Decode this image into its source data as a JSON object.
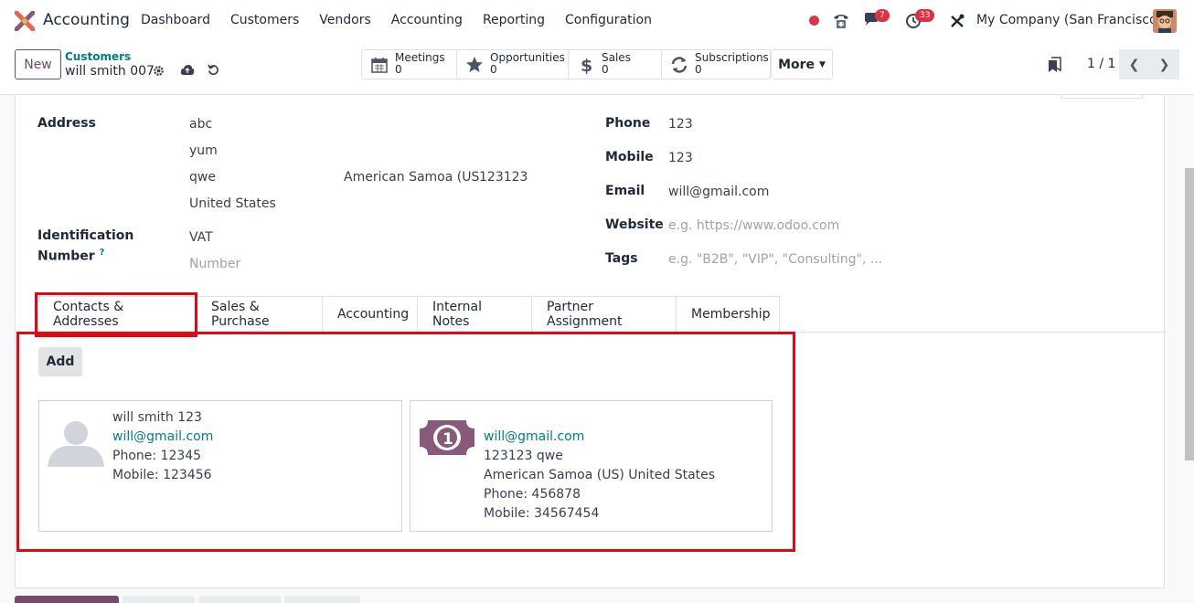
{
  "nav": {
    "app_name": "Accounting",
    "menu": [
      "Dashboard",
      "Customers",
      "Vendors",
      "Accounting",
      "Reporting",
      "Configuration"
    ],
    "chat_badge": "7",
    "activity_badge": "33",
    "company": "My Company (San Francisco)"
  },
  "control": {
    "new_label": "New",
    "breadcrumb_parent": "Customers",
    "breadcrumb_current": "will smith 007",
    "stats": [
      {
        "label": "Meetings",
        "value": "0"
      },
      {
        "label": "Opportunities",
        "value": "0"
      },
      {
        "label": "Sales",
        "value": "0"
      },
      {
        "label": "Subscriptions",
        "value": "0"
      }
    ],
    "more_label": "More",
    "pager": "1 / 1"
  },
  "form": {
    "address_label": "Address",
    "street": "abc",
    "street2": "yum",
    "city": "qwe",
    "state": "American Samoa (US",
    "zip": "123123",
    "country": "United States",
    "id_label_1": "Identification",
    "id_label_2": "Number",
    "id_help": "?",
    "vat_type": "VAT",
    "vat_placeholder": "Number",
    "phone_label": "Phone",
    "phone": "123",
    "mobile_label": "Mobile",
    "mobile": "123",
    "email_label": "Email",
    "email": "will@gmail.com",
    "website_label": "Website",
    "website_placeholder": "e.g. https://www.odoo.com",
    "tags_label": "Tags",
    "tags_placeholder": "e.g. \"B2B\", \"VIP\", \"Consulting\", ..."
  },
  "tabs": [
    "Contacts & Addresses",
    "Sales & Purchase",
    "Accounting",
    "Internal Notes",
    "Partner Assignment",
    "Membership"
  ],
  "contacts": {
    "add_label": "Add",
    "cards": [
      {
        "name": "will smith 123",
        "email": "will@gmail.com",
        "phone": "Phone: 12345",
        "mobile": "Mobile: 123456"
      },
      {
        "email": "will@gmail.com",
        "addr1": "123123 qwe",
        "addr2": "American Samoa (US) United States",
        "phone": "Phone: 456878",
        "mobile": "Mobile: 34567454"
      }
    ]
  },
  "colors": {
    "brand": "#714b67",
    "link": "#017e84",
    "highlight": "#e30613",
    "badge": "#e0323e"
  }
}
